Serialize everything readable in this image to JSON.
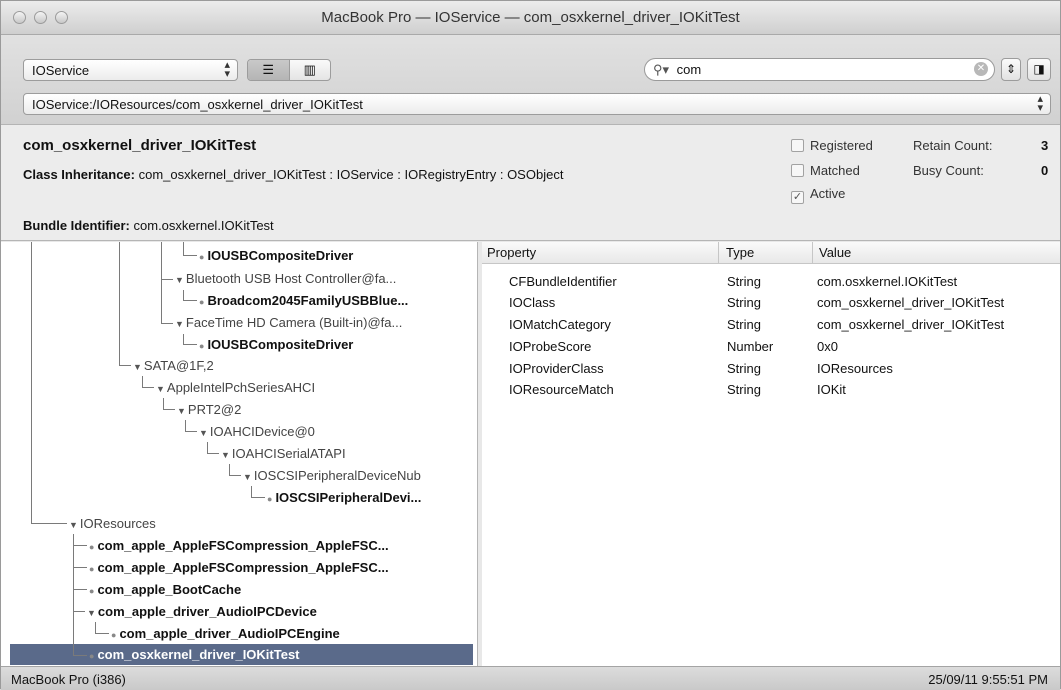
{
  "window": {
    "title": "MacBook Pro — IOService — com_osxkernel_driver_IOKitTest"
  },
  "toolbar": {
    "plane": "IOService",
    "search_value": "com",
    "path": "IOService:/IOResources/com_osxkernel_driver_IOKitTest"
  },
  "info": {
    "name": "com_osxkernel_driver_IOKitTest",
    "inheritance_label": "Class Inheritance:",
    "inheritance": "com_osxkernel_driver_IOKitTest : IOService : IORegistryEntry : OSObject",
    "bundle_label": "Bundle Identifier:",
    "bundle": "com.osxkernel.IOKitTest",
    "registered": "Registered",
    "matched": "Matched",
    "active": "Active",
    "retain_label": "Retain Count:",
    "retain_value": "3",
    "busy_label": "Busy Count:",
    "busy_value": "0"
  },
  "tree": [
    {
      "label": "IOUSBCompositeDriver",
      "bold": true,
      "leaf": true
    },
    {
      "label": "Bluetooth USB Host Controller@fa...",
      "bold": false,
      "leaf": false
    },
    {
      "label": "Broadcom2045FamilyUSBBlue...",
      "bold": true,
      "leaf": true
    },
    {
      "label": "FaceTime HD Camera (Built-in)@fa...",
      "bold": false,
      "leaf": false
    },
    {
      "label": "IOUSBCompositeDriver",
      "bold": true,
      "leaf": true
    },
    {
      "label": "SATA@1F,2",
      "bold": false,
      "leaf": false
    },
    {
      "label": "AppleIntelPchSeriesAHCI",
      "bold": false,
      "leaf": false
    },
    {
      "label": "PRT2@2",
      "bold": false,
      "leaf": false
    },
    {
      "label": "IOAHCIDevice@0",
      "bold": false,
      "leaf": false
    },
    {
      "label": "IOAHCISerialATAPI",
      "bold": false,
      "leaf": false
    },
    {
      "label": "IOSCSIPeripheralDeviceNub",
      "bold": false,
      "leaf": false
    },
    {
      "label": "IOSCSIPeripheralDevi...",
      "bold": true,
      "leaf": true
    },
    {
      "label": "IOResources",
      "bold": false,
      "leaf": false
    },
    {
      "label": "com_apple_AppleFSCompression_AppleFSC...",
      "bold": true,
      "leaf": true
    },
    {
      "label": "com_apple_AppleFSCompression_AppleFSC...",
      "bold": true,
      "leaf": true
    },
    {
      "label": "com_apple_BootCache",
      "bold": true,
      "leaf": true
    },
    {
      "label": "com_apple_driver_AudioIPCDevice",
      "bold": true,
      "leaf": false
    },
    {
      "label": "com_apple_driver_AudioIPCEngine",
      "bold": true,
      "leaf": true
    },
    {
      "label": "com_osxkernel_driver_IOKitTest",
      "bold": true,
      "leaf": true
    }
  ],
  "props": {
    "headers": [
      "Property",
      "Type",
      "Value"
    ],
    "rows": [
      [
        "CFBundleIdentifier",
        "String",
        "com.osxkernel.IOKitTest"
      ],
      [
        "IOClass",
        "String",
        "com_osxkernel_driver_IOKitTest"
      ],
      [
        "IOMatchCategory",
        "String",
        "com_osxkernel_driver_IOKitTest"
      ],
      [
        "IOProbeScore",
        "Number",
        "0x0"
      ],
      [
        "IOProviderClass",
        "String",
        "IOResources"
      ],
      [
        "IOResourceMatch",
        "String",
        "IOKit"
      ]
    ]
  },
  "status": {
    "left": "MacBook Pro (i386)",
    "right": "25/09/11 9:55:51 PM"
  }
}
